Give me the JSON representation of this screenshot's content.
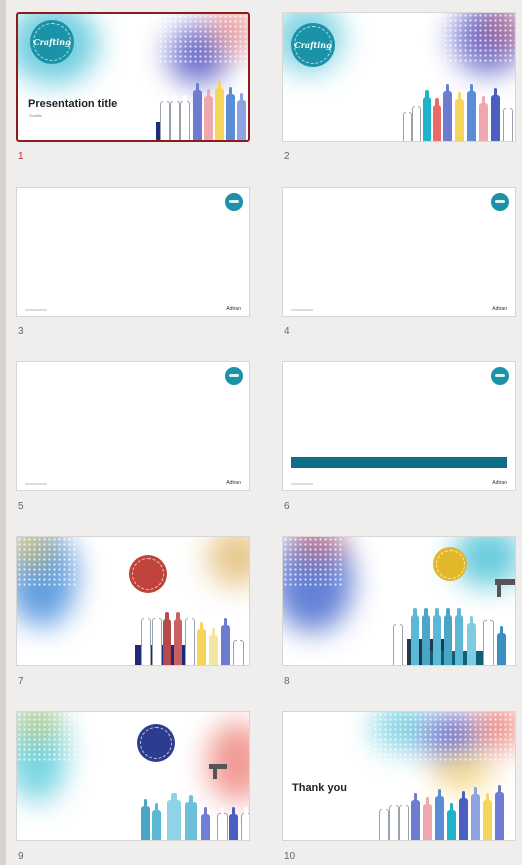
{
  "slides": [
    {
      "number": "1",
      "title": "Presentation title",
      "subtitle": "Subtitle",
      "badge_text": "Crafting"
    },
    {
      "number": "2",
      "badge_text": "Crafting"
    },
    {
      "number": "3",
      "brand": "Adtran"
    },
    {
      "number": "4",
      "brand": "Adtran"
    },
    {
      "number": "5",
      "brand": "Adtran"
    },
    {
      "number": "6",
      "brand": "Adtran"
    },
    {
      "number": "7"
    },
    {
      "number": "8"
    },
    {
      "number": "9"
    },
    {
      "number": "10",
      "title": "Thank you"
    }
  ],
  "colors": {
    "selected_border": "#8b1c1c",
    "brand_teal": "#1a93a8",
    "bar_teal": "#0f6e87"
  },
  "icons": [
    "badge-icon",
    "bottle-icon"
  ]
}
